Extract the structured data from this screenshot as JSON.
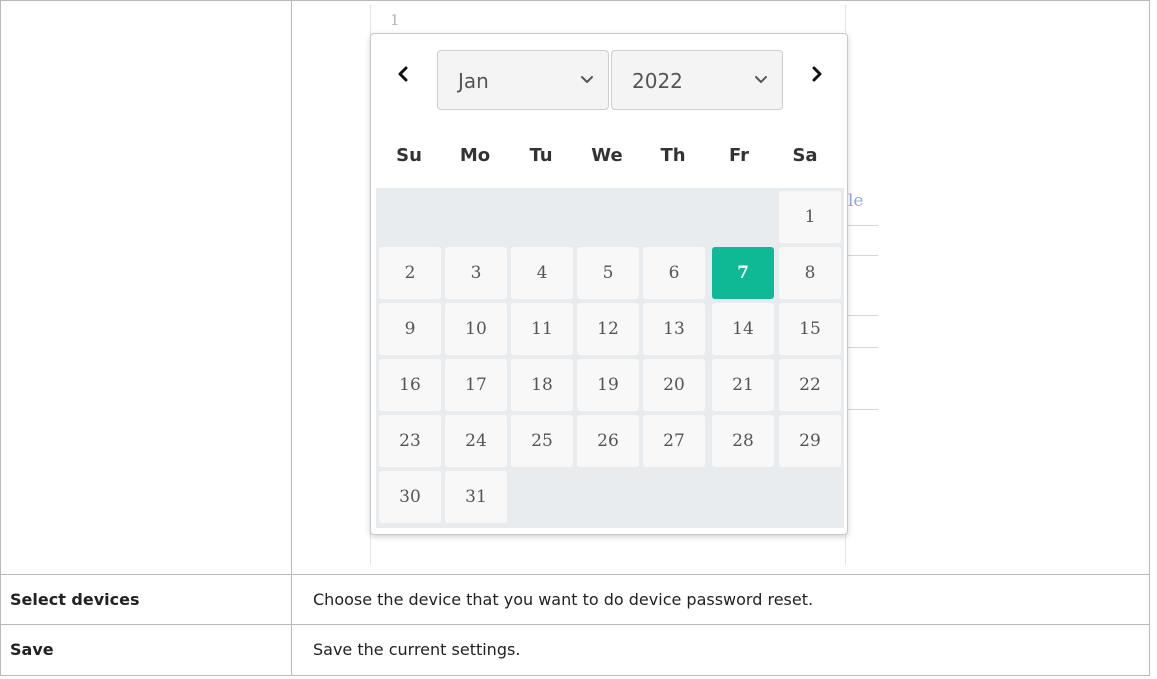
{
  "datepicker": {
    "month": "Jan",
    "year": "2022",
    "weekdays": [
      "Su",
      "Mo",
      "Tu",
      "We",
      "Th",
      "Fr",
      "Sa"
    ],
    "days": [
      "1",
      "2",
      "3",
      "4",
      "5",
      "6",
      "7",
      "8",
      "9",
      "10",
      "11",
      "12",
      "13",
      "14",
      "15",
      "16",
      "17",
      "18",
      "19",
      "20",
      "21",
      "22",
      "23",
      "24",
      "25",
      "26",
      "27",
      "28",
      "29",
      "30",
      "31"
    ],
    "selected_day": "7",
    "colors": {
      "selected": "#10b996"
    }
  },
  "background": {
    "fragment_top": "1",
    "fragment_side": "le"
  },
  "table": {
    "rows": [
      {
        "label": "Select devices",
        "description": "Choose the device that you want to do device password reset."
      },
      {
        "label": "Save",
        "description": "Save the current settings."
      }
    ]
  }
}
